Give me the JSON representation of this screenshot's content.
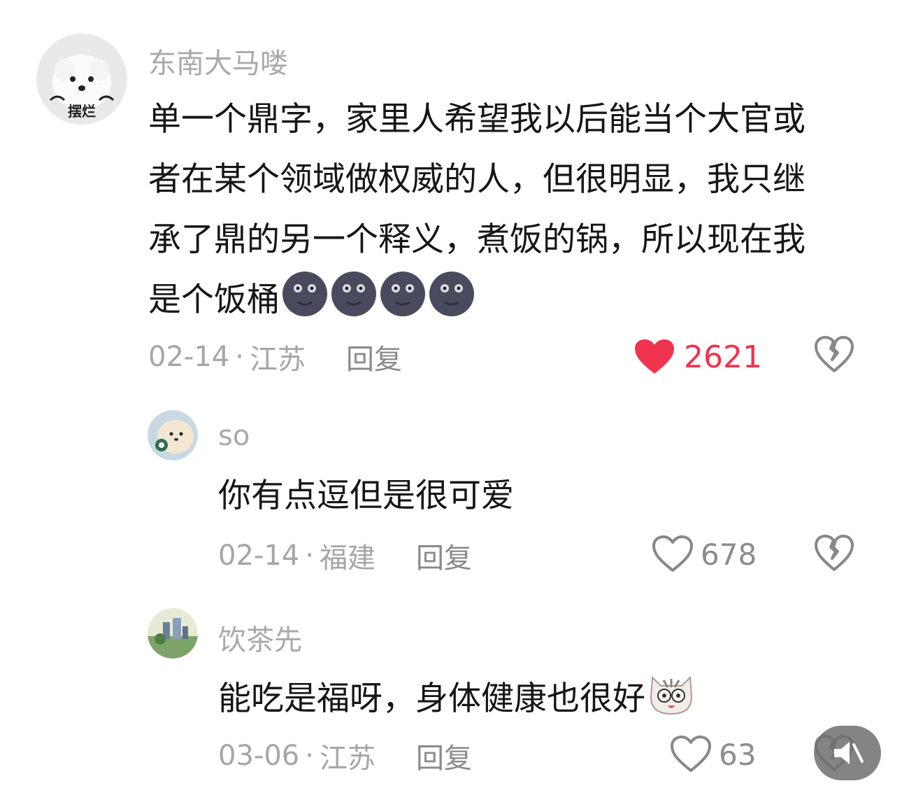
{
  "comments": [
    {
      "username": "东南大马喽",
      "avatar_text": "摆烂",
      "content": "单一个鼎字，家里人希望我以后能当个大官或者在某个领域做权威的人，但很明显，我只继承了鼎的另一个释义，煮饭的锅，所以现在我是个饭桶",
      "emoji": "new-moon-face-emoji",
      "date": "02-14",
      "separator": "·",
      "location": "江苏",
      "reply_label": "回复",
      "likes": "2621",
      "liked": true
    },
    {
      "username": "so",
      "content": "你有点逗但是很可爱",
      "date": "02-14",
      "separator": "·",
      "location": "福建",
      "reply_label": "回复",
      "likes": "678",
      "liked": false
    },
    {
      "username": "饮茶先",
      "content": "能吃是福呀，身体健康也很好",
      "emoji": "cat-face-emoji",
      "date": "03-06",
      "separator": "·",
      "location": "江苏",
      "reply_label": "回复",
      "likes": "63",
      "liked": false
    }
  ],
  "colors": {
    "liked_heart": "#f0334f",
    "username": "#a9a9a9",
    "meta": "#a6a6a6"
  }
}
